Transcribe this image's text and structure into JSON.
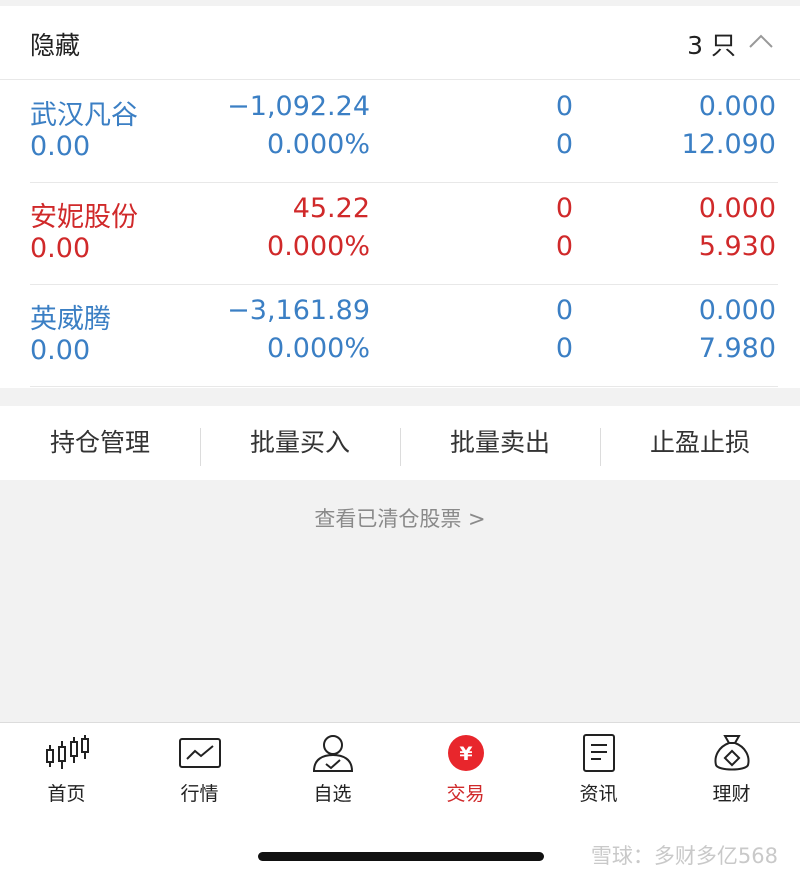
{
  "hidden_section": {
    "title": "隐藏",
    "count": "3 只"
  },
  "holdings": [
    {
      "name": "武汉凡谷",
      "value_a": "0.00",
      "pl": "−1,092.24",
      "pl_pct": "0.000%",
      "qty": "0",
      "avail": "0",
      "price": "0.000",
      "cost": "12.090",
      "color": "#3b7fc4"
    },
    {
      "name": "安妮股份",
      "value_a": "0.00",
      "pl": "45.22",
      "pl_pct": "0.000%",
      "qty": "0",
      "avail": "0",
      "price": "0.000",
      "cost": "5.930",
      "color": "#d0292a"
    },
    {
      "name": "英威腾",
      "value_a": "0.00",
      "pl": "−3,161.89",
      "pl_pct": "0.000%",
      "qty": "0",
      "avail": "0",
      "price": "0.000",
      "cost": "7.980",
      "color": "#3b7fc4"
    }
  ],
  "actions": [
    "持仓管理",
    "批量买入",
    "批量卖出",
    "止盈止损"
  ],
  "view_cleared": "查看已清仓股票 >",
  "tabs": [
    {
      "label": "首页",
      "icon": "candlestick-icon"
    },
    {
      "label": "行情",
      "icon": "market-chart-icon"
    },
    {
      "label": "自选",
      "icon": "user-check-icon"
    },
    {
      "label": "交易",
      "icon": "yuan-circle-icon",
      "active": true
    },
    {
      "label": "资讯",
      "icon": "document-icon"
    },
    {
      "label": "理财",
      "icon": "money-bag-icon"
    }
  ],
  "watermark": "雪球：多财多亿568",
  "colors": {
    "accent_red": "#d0292a",
    "accent_blue": "#3b7fc4"
  }
}
